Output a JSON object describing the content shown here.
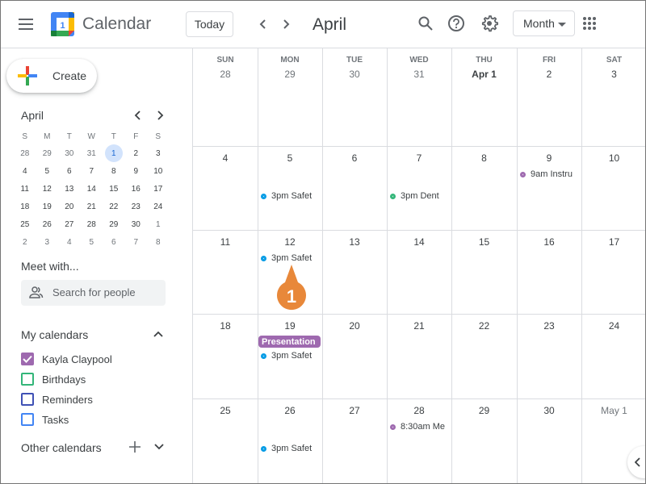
{
  "header": {
    "app_title": "Calendar",
    "logo_day": "1",
    "today_label": "Today",
    "month_title": "April",
    "view_selected": "Month",
    "icons": [
      "menu-icon",
      "prev-icon",
      "next-icon",
      "search-icon",
      "help-icon",
      "settings-icon",
      "apps-icon"
    ]
  },
  "sidebar": {
    "create_label": "Create",
    "mini_calendar": {
      "title": "April",
      "weekdays": [
        "S",
        "M",
        "T",
        "W",
        "T",
        "F",
        "S"
      ],
      "weeks": [
        [
          {
            "d": "28",
            "o": true
          },
          {
            "d": "29",
            "o": true
          },
          {
            "d": "30",
            "o": true
          },
          {
            "d": "31",
            "o": true
          },
          {
            "d": "1",
            "today": true
          },
          {
            "d": "2"
          },
          {
            "d": "3"
          }
        ],
        [
          {
            "d": "4"
          },
          {
            "d": "5"
          },
          {
            "d": "6"
          },
          {
            "d": "7"
          },
          {
            "d": "8"
          },
          {
            "d": "9"
          },
          {
            "d": "10"
          }
        ],
        [
          {
            "d": "11"
          },
          {
            "d": "12"
          },
          {
            "d": "13"
          },
          {
            "d": "14"
          },
          {
            "d": "15"
          },
          {
            "d": "16"
          },
          {
            "d": "17"
          }
        ],
        [
          {
            "d": "18"
          },
          {
            "d": "19"
          },
          {
            "d": "20"
          },
          {
            "d": "21"
          },
          {
            "d": "22"
          },
          {
            "d": "23"
          },
          {
            "d": "24"
          }
        ],
        [
          {
            "d": "25"
          },
          {
            "d": "26"
          },
          {
            "d": "27"
          },
          {
            "d": "28"
          },
          {
            "d": "29"
          },
          {
            "d": "30"
          },
          {
            "d": "1",
            "o": true
          }
        ],
        [
          {
            "d": "2",
            "o": true
          },
          {
            "d": "3",
            "o": true
          },
          {
            "d": "4",
            "o": true
          },
          {
            "d": "5",
            "o": true
          },
          {
            "d": "6",
            "o": true
          },
          {
            "d": "7",
            "o": true
          },
          {
            "d": "8",
            "o": true
          }
        ]
      ]
    },
    "meet_with": {
      "title": "Meet with...",
      "search_placeholder": "Search for people"
    },
    "my_calendars": {
      "title": "My calendars",
      "items": [
        {
          "name": "Kayla Claypool",
          "color": "#9e69af",
          "checked": true
        },
        {
          "name": "Birthdays",
          "color": "#33b679",
          "checked": false
        },
        {
          "name": "Reminders",
          "color": "#3f51b5",
          "checked": false
        },
        {
          "name": "Tasks",
          "color": "#4285f4",
          "checked": false
        }
      ]
    },
    "other_calendars": {
      "title": "Other calendars"
    }
  },
  "month": {
    "weekdays": [
      "SUN",
      "MON",
      "TUE",
      "WED",
      "THU",
      "FRI",
      "SAT"
    ],
    "weeks": [
      [
        {
          "label": "28",
          "muted": true
        },
        {
          "label": "29",
          "muted": true
        },
        {
          "label": "30",
          "muted": true
        },
        {
          "label": "31",
          "muted": true
        },
        {
          "label": "Apr 1",
          "bold": true
        },
        {
          "label": "2"
        },
        {
          "label": "3"
        }
      ],
      [
        {
          "label": "4"
        },
        {
          "label": "5"
        },
        {
          "label": "6"
        },
        {
          "label": "7"
        },
        {
          "label": "8"
        },
        {
          "label": "9"
        },
        {
          "label": "10"
        }
      ],
      [
        {
          "label": "11"
        },
        {
          "label": "12"
        },
        {
          "label": "13"
        },
        {
          "label": "14"
        },
        {
          "label": "15"
        },
        {
          "label": "16"
        },
        {
          "label": "17"
        }
      ],
      [
        {
          "label": "18"
        },
        {
          "label": "19"
        },
        {
          "label": "20"
        },
        {
          "label": "21"
        },
        {
          "label": "22"
        },
        {
          "label": "23"
        },
        {
          "label": "24"
        }
      ],
      [
        {
          "label": "25"
        },
        {
          "label": "26"
        },
        {
          "label": "27"
        },
        {
          "label": "28"
        },
        {
          "label": "29"
        },
        {
          "label": "30"
        },
        {
          "label": "May 1",
          "muted": true
        }
      ]
    ],
    "events": [
      {
        "week": 1,
        "day": 1,
        "slot": 1,
        "text": "3pm Safet",
        "color": "#039be5",
        "type": "timed"
      },
      {
        "week": 1,
        "day": 3,
        "slot": 1,
        "text": "3pm Dent",
        "color": "#33b679",
        "type": "timed"
      },
      {
        "week": 1,
        "day": 5,
        "slot": 0,
        "text": "9am Instru",
        "color": "#9e69af",
        "type": "timed"
      },
      {
        "week": 2,
        "day": 1,
        "slot": 0,
        "text": "3pm Safet",
        "color": "#039be5",
        "type": "timed"
      },
      {
        "week": 3,
        "day": 1,
        "slot": 0,
        "text": "Presentation",
        "color": "#9e69af",
        "type": "allday"
      },
      {
        "week": 3,
        "day": 1,
        "slot": 1,
        "text": "3pm Safet",
        "color": "#039be5",
        "type": "timed"
      },
      {
        "week": 4,
        "day": 1,
        "slot": 1,
        "text": "3pm Safet",
        "color": "#039be5",
        "type": "timed"
      },
      {
        "week": 4,
        "day": 3,
        "slot": 0,
        "text": "8:30am Me",
        "color": "#9e69af",
        "type": "timed"
      }
    ]
  },
  "callout": {
    "number": "1",
    "color": "#e8883a"
  }
}
